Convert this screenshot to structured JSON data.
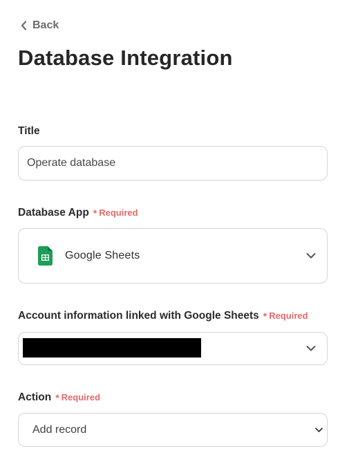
{
  "header": {
    "back_label": "Back",
    "title": "Database Integration"
  },
  "title_field": {
    "label": "Title",
    "value": "Operate database"
  },
  "database_app": {
    "label": "Database App",
    "required_mark": "*",
    "required_label": "Required",
    "selected": "Google Sheets",
    "icon": "google-sheets-icon"
  },
  "account_info": {
    "label": "Account information linked with Google Sheets",
    "required_mark": "*",
    "required_label": "Required",
    "value_redacted": true
  },
  "action": {
    "label": "Action",
    "required_mark": "*",
    "required_label": "Required",
    "selected": "Add record"
  },
  "colors": {
    "required": "#e36a6a",
    "border": "#d5d5d5",
    "sheets_green": "#1e9e5a"
  }
}
